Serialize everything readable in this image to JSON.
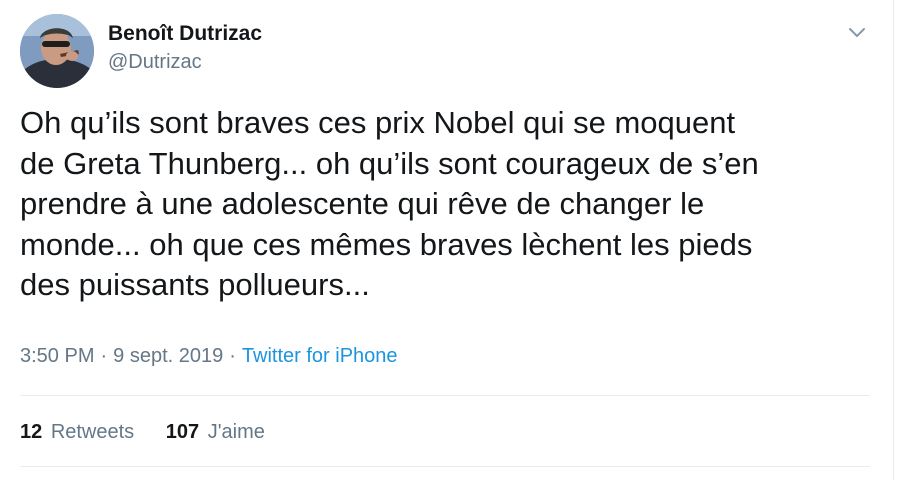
{
  "author": {
    "name": "Benoît Dutrizac",
    "handle": "@Dutrizac",
    "avatar_icon": "profile-photo"
  },
  "menu": {
    "icon": "chevron-down-icon"
  },
  "tweet": {
    "lines": [
      "Oh qu’ils sont braves ces prix Nobel qui se moquent",
      "de Greta Thunberg... oh qu’ils sont courageux de s’en",
      "prendre à une adolescente qui rêve de changer le",
      "monde... oh que ces mêmes braves lèchent les pieds",
      "des puissants pollueurs..."
    ]
  },
  "meta": {
    "time": "3:50 PM",
    "separator": "·",
    "date": "9 sept. 2019",
    "source": "Twitter for iPhone"
  },
  "stats": {
    "retweets_count": "12",
    "retweets_label": "Retweets",
    "likes_count": "107",
    "likes_label": "J'aime"
  },
  "colors": {
    "text": "#14171a",
    "secondary": "#657786",
    "link": "#1b95e0",
    "divider": "#e6ecf0"
  }
}
